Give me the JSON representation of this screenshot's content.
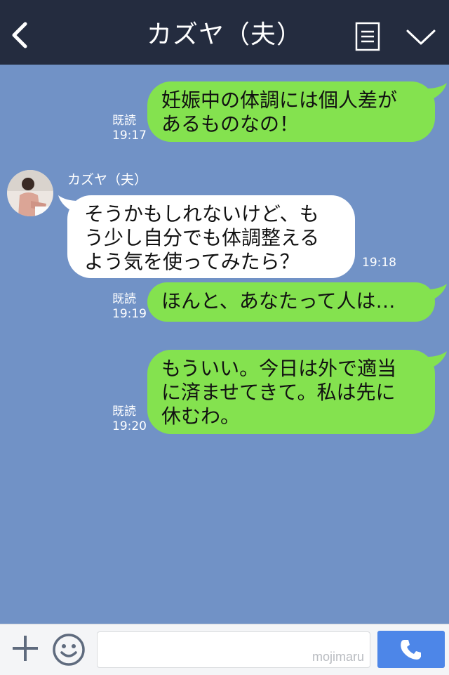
{
  "header": {
    "title": "カズヤ（夫）",
    "back_icon": "chevron-left-icon",
    "menu_icon": "note-list-icon",
    "expand_icon": "chevron-down-icon"
  },
  "messages": [
    {
      "direction": "outgoing",
      "text": "妊娠中の体調には個人差が\nあるものなの！",
      "read_label": "既読",
      "time": "19:17"
    },
    {
      "direction": "incoming",
      "sender": "カズヤ（夫）",
      "text": "そうかもしれないけど、も\nう少し自分でも体調整える\nよう気を使ってみたら？",
      "time": "19:18"
    },
    {
      "direction": "outgoing",
      "text": "ほんと、あなたって人は…",
      "read_label": "既読",
      "time": "19:19"
    },
    {
      "direction": "outgoing",
      "text": "もういい。今日は外で適当\nに済ませてきて。私は先に\n休むわ。",
      "read_label": "既読",
      "time": "19:20"
    }
  ],
  "footer": {
    "plus_icon": "plus-icon",
    "emoji_icon": "smiley-icon",
    "input_value": "",
    "watermark": "mojimaru",
    "call_icon": "phone-icon"
  },
  "colors": {
    "header_bg": "#242c3f",
    "chat_bg": "#7192c6",
    "outgoing_bubble": "#84e24f",
    "incoming_bubble": "#ffffff",
    "call_button": "#4d86e8"
  }
}
